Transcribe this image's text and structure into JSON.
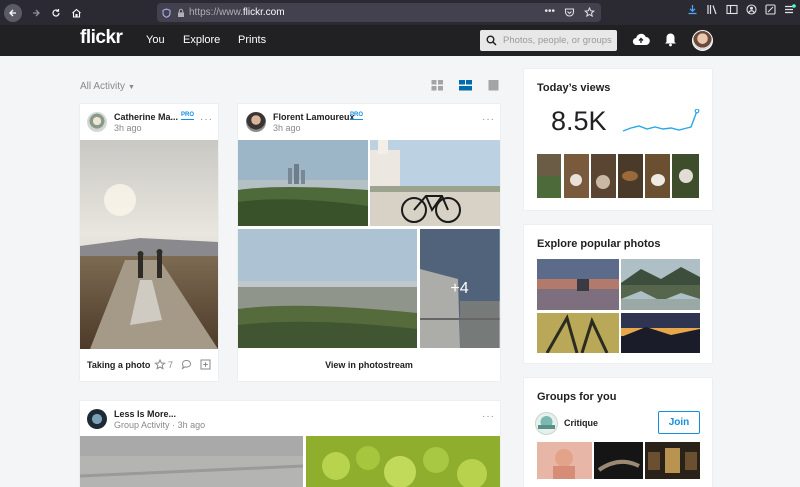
{
  "browser": {
    "url_prefix": "https://www.",
    "url_domain": "flickr.com",
    "colors": {
      "bg": "#2b2a33",
      "urlbar": "#42414d"
    }
  },
  "header": {
    "logo": "flickr",
    "nav": [
      "You",
      "Explore",
      "Prints"
    ],
    "search_placeholder": "Photos, people, or groups"
  },
  "feed": {
    "filter_label": "All Activity",
    "cards": [
      {
        "user": "Catherine Ma...",
        "pro": "PRO",
        "time": "3h ago",
        "caption": "Taking a photo",
        "faves": "7"
      },
      {
        "user": "Florent Lamoureux",
        "pro": "PRO",
        "time": "3h ago",
        "more_count": "+4",
        "link": "View in photostream"
      },
      {
        "user": "Less Is More...",
        "subtitle": "Group Activity",
        "dot": "·",
        "time": "3h ago"
      }
    ]
  },
  "sidebar": {
    "views": {
      "title": "Today’s views",
      "value": "8.5K"
    },
    "explore": {
      "title": "Explore popular photos"
    },
    "groups": {
      "title": "Groups for you",
      "group_name": "Critique",
      "join_label": "Join"
    }
  },
  "colors": {
    "accent": "#128fdc",
    "header_bg": "#212124",
    "page_bg": "#f3f5f6"
  }
}
